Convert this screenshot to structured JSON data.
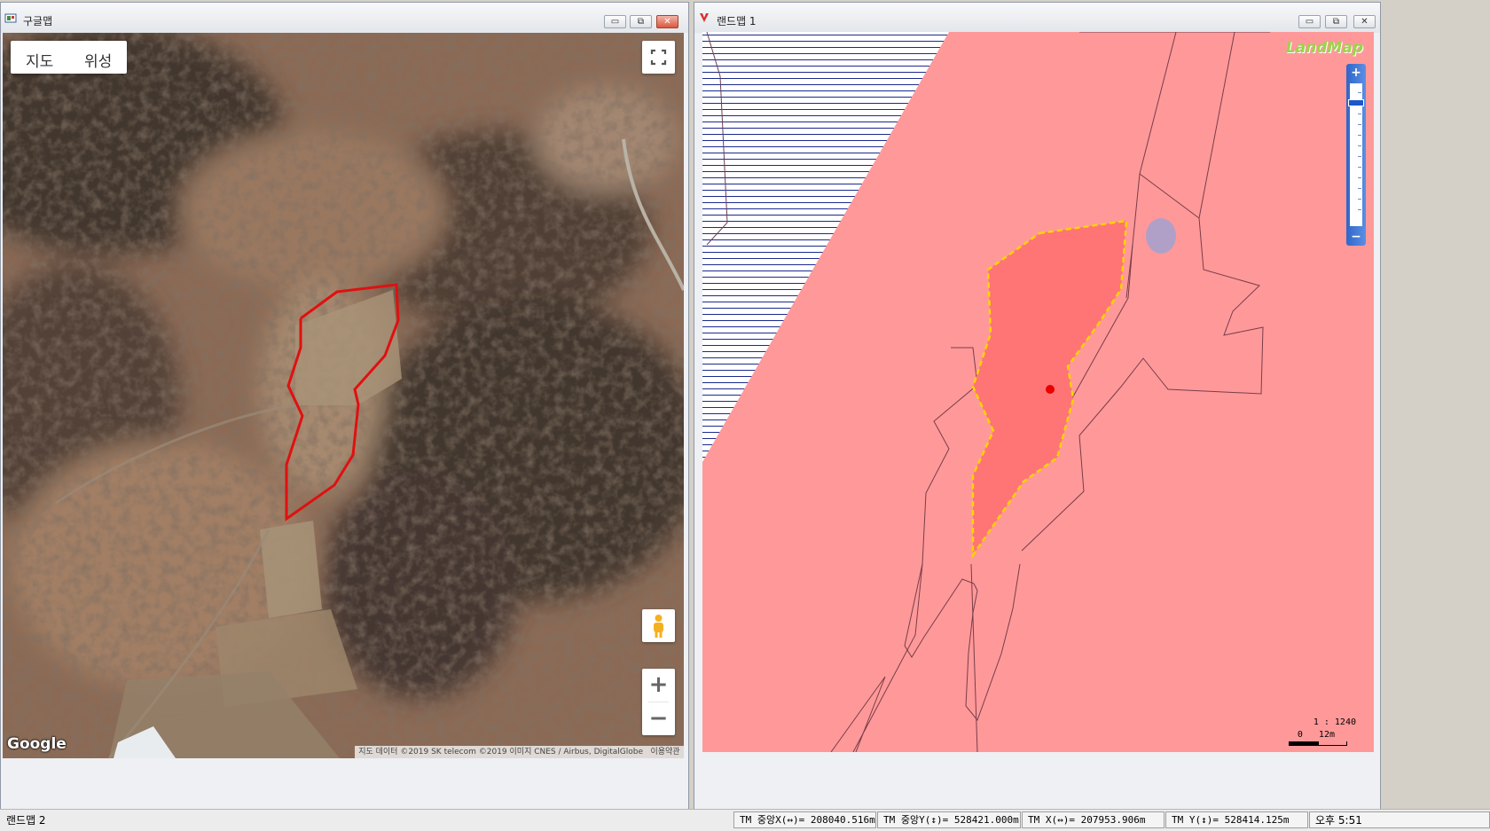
{
  "google_window": {
    "title": "구글맵",
    "buttons": {
      "minimize": "▭",
      "restore": "⧉",
      "close": "✕"
    },
    "map_type": {
      "map_label": "지도",
      "satellite_label": "위성"
    },
    "attribution": "지도 데이터 ©2019 SK telecom ©2019 이미지 CNES / Airbus, DigitalGlobe",
    "terms_label": "이용약관",
    "logo": "Google",
    "zoom_in_label": "+",
    "zoom_out_label": "−",
    "icons": [
      "fullscreen-icon",
      "pegman-icon"
    ]
  },
  "landmap_window": {
    "title": "랜드맵 1",
    "buttons": {
      "minimize": "▭",
      "restore": "⧉",
      "close": "✕"
    },
    "logo": "LandMap",
    "zoom_in_label": "+",
    "zoom_out_label": "−",
    "scale_ratio": "1 : 1240",
    "scale_bar": "0   12m",
    "colors": {
      "parcel_fill": "#ff9999",
      "selected_fill": "#ff7474",
      "selection_outline": "#ffd400",
      "marker": "#e80000"
    }
  },
  "statusbar": {
    "window_label": "랜드맵 2",
    "tm_center_x": "TM 중앙X(↔)= 208040.516m",
    "tm_center_y": "TM 중앙Y(↕)= 528421.000m",
    "tm_x": "TM X(↔)= 207953.906m",
    "tm_y": "TM Y(↕)= 528414.125m",
    "clock": "오후 5:51"
  },
  "colors": {
    "google_outline": "#e01010"
  }
}
